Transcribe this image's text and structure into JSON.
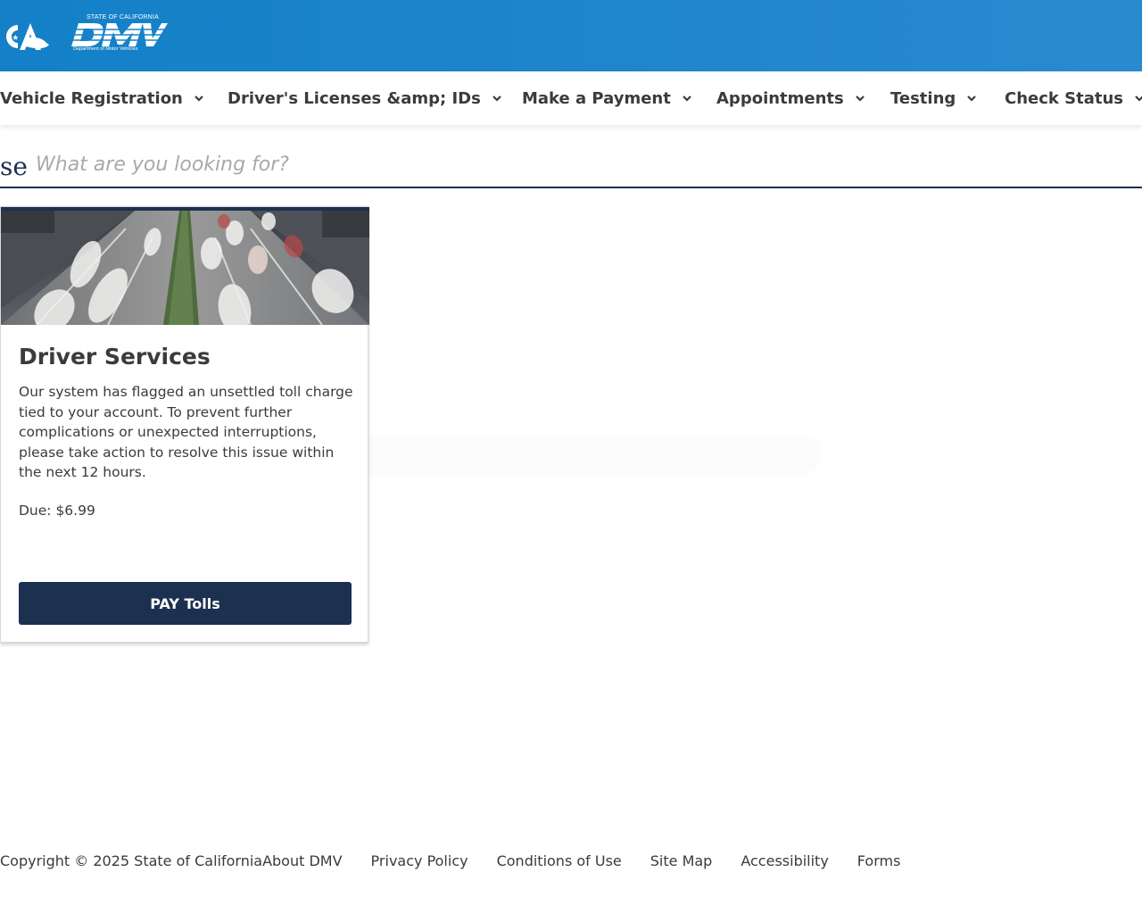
{
  "header": {
    "ca_logo_text": "CA",
    "dmv_logo_top": "STATE OF CALIFORNIA",
    "dmv_logo_mark": "DMV",
    "dmv_logo_bottom": "Department of Motor Vehicles",
    "brand_color": "#1380c7"
  },
  "nav": {
    "items": [
      {
        "label": "Vehicle Registration",
        "icon": "chevron-down-icon"
      },
      {
        "label": "Driver's Licenses &amp; IDs",
        "icon": "chevron-down-icon"
      },
      {
        "label": "Make a Payment",
        "icon": "chevron-down-icon"
      },
      {
        "label": "Appointments",
        "icon": "chevron-down-icon"
      },
      {
        "label": "Testing",
        "icon": "chevron-down-icon"
      },
      {
        "label": "Check Status",
        "icon": "chevron-down-icon"
      }
    ]
  },
  "search": {
    "prefix": "se",
    "placeholder": "What are you looking for?",
    "value": ""
  },
  "card": {
    "title": "Driver Services",
    "body": "Our system has flagged an unsettled toll charge tied to your account. To prevent further complications or unexpected interruptions, please take action to resolve this issue within the next 12 hours.",
    "due": "Due: $6.99",
    "button_label": "PAY Tolls",
    "accent_color": "#1c3050"
  },
  "footer": {
    "copyright": "Copyright © 2025 State of California",
    "links": [
      "About DMV",
      "Privacy Policy",
      "Conditions of Use",
      "Site Map",
      "Accessibility",
      "Forms"
    ]
  }
}
